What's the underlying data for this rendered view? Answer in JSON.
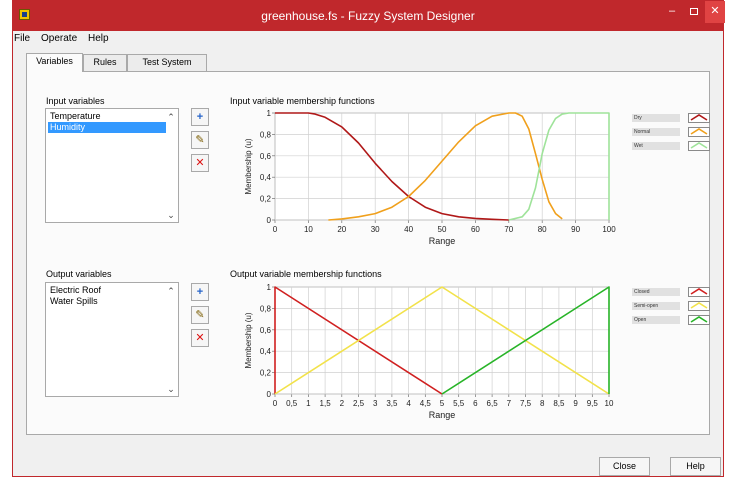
{
  "window": {
    "title": "greenhouse.fs - Fuzzy System Designer",
    "close_glyph": "✕",
    "min_glyph": "–"
  },
  "menu": [
    "File",
    "Operate",
    "Help"
  ],
  "tabs": [
    "Variables",
    "Rules",
    "Test System"
  ],
  "active_tab": "Variables",
  "input": {
    "heading": "Input variables",
    "items": [
      "Temperature",
      "Humidity"
    ],
    "selected": "Humidity",
    "chart_title": "Input variable membership functions"
  },
  "output": {
    "heading": "Output variables",
    "items": [
      "Electric Roof",
      "Water Spills"
    ],
    "chart_title": "Output variable membership functions"
  },
  "buttons": {
    "add": "+",
    "edit": "✎",
    "delete": "✕",
    "close": "Close",
    "help": "Help"
  },
  "scroll": {
    "up": "⌃",
    "down": "⌄"
  },
  "chart_data": [
    {
      "type": "line",
      "title": "Input variable membership functions",
      "xlabel": "Range",
      "ylabel": "Membership (u)",
      "xlim": [
        0,
        100
      ],
      "ylim": [
        0,
        1
      ],
      "x_ticks": [
        "0",
        "10",
        "20",
        "30",
        "40",
        "50",
        "60",
        "70",
        "80",
        "90",
        "100"
      ],
      "y_ticks": [
        "0",
        "0,2",
        "0,4",
        "0,6",
        "0,8",
        "1"
      ],
      "grid": true,
      "legend_position": "right",
      "series": [
        {
          "name": "Dry",
          "color": "#b01818",
          "x": [
            0,
            10,
            12,
            15,
            20,
            25,
            30,
            35,
            40,
            45,
            50,
            55,
            60,
            65,
            70
          ],
          "y": [
            1,
            1,
            0.99,
            0.96,
            0.87,
            0.72,
            0.53,
            0.36,
            0.22,
            0.12,
            0.06,
            0.03,
            0.015,
            0.007,
            0
          ]
        },
        {
          "name": "Normal",
          "color": "#f0a01c",
          "x": [
            16,
            20,
            25,
            30,
            35,
            40,
            45,
            50,
            55,
            60,
            65,
            70,
            72,
            74,
            76,
            78,
            80,
            82,
            84,
            86
          ],
          "y": [
            0,
            0.01,
            0.03,
            0.06,
            0.12,
            0.22,
            0.37,
            0.55,
            0.73,
            0.88,
            0.97,
            1,
            1,
            0.97,
            0.85,
            0.62,
            0.38,
            0.17,
            0.06,
            0.01
          ]
        },
        {
          "name": "Wet",
          "color": "#9fe39a",
          "x": [
            70,
            74,
            76,
            78,
            80,
            82,
            84,
            86,
            88,
            90,
            95,
            100,
            100
          ],
          "y": [
            0,
            0.03,
            0.1,
            0.3,
            0.62,
            0.84,
            0.95,
            0.99,
            1,
            1,
            1,
            1,
            0
          ]
        }
      ]
    },
    {
      "type": "line",
      "title": "Output variable membership functions",
      "xlabel": "Range",
      "ylabel": "Membership (u)",
      "xlim": [
        0,
        10
      ],
      "ylim": [
        0,
        1
      ],
      "x_ticks": [
        "0",
        "0,5",
        "1",
        "1,5",
        "2",
        "2,5",
        "3",
        "3,5",
        "4",
        "4,5",
        "5",
        "5,5",
        "6",
        "6,5",
        "7",
        "7,5",
        "8",
        "8,5",
        "9",
        "9,5",
        "10"
      ],
      "y_ticks": [
        "0",
        "0,2",
        "0,4",
        "0,6",
        "0,8",
        "1"
      ],
      "grid": true,
      "legend_position": "right",
      "series": [
        {
          "name": "Closed",
          "color": "#d02020",
          "x": [
            0,
            0,
            5
          ],
          "y": [
            0,
            1,
            0
          ]
        },
        {
          "name": "Semi-open",
          "color": "#f2e24a",
          "x": [
            0,
            5,
            10
          ],
          "y": [
            0,
            1,
            0
          ]
        },
        {
          "name": "Open",
          "color": "#28b428",
          "x": [
            5,
            10,
            10
          ],
          "y": [
            0,
            1,
            0
          ]
        }
      ]
    }
  ]
}
